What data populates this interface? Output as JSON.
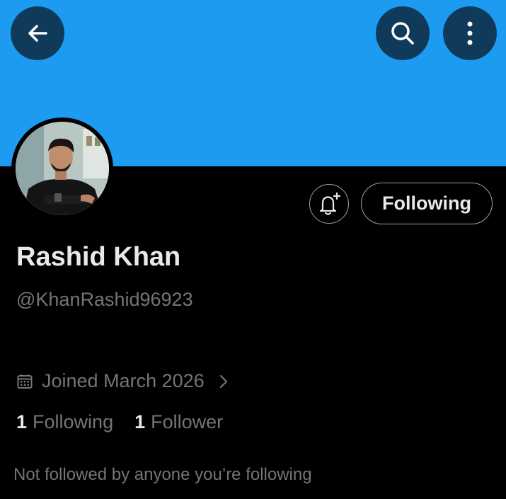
{
  "header": {
    "back_icon": "arrow-left-icon",
    "search_icon": "search-icon",
    "more_icon": "more-vertical-icon",
    "banner_color": "#1d9bf0",
    "button_bg": "#0f3a5a"
  },
  "profile": {
    "avatar_icon": "avatar",
    "name": "Rashid Khan",
    "handle": "@KhanRashid96923",
    "joined": "Joined March 2026",
    "follow_button_label": "Following",
    "notify_icon": "bell-plus-icon"
  },
  "stats": {
    "following_count": "1",
    "following_label": "Following",
    "followers_count": "1",
    "followers_label": "Follower"
  },
  "note": "Not followed by anyone you’re following"
}
